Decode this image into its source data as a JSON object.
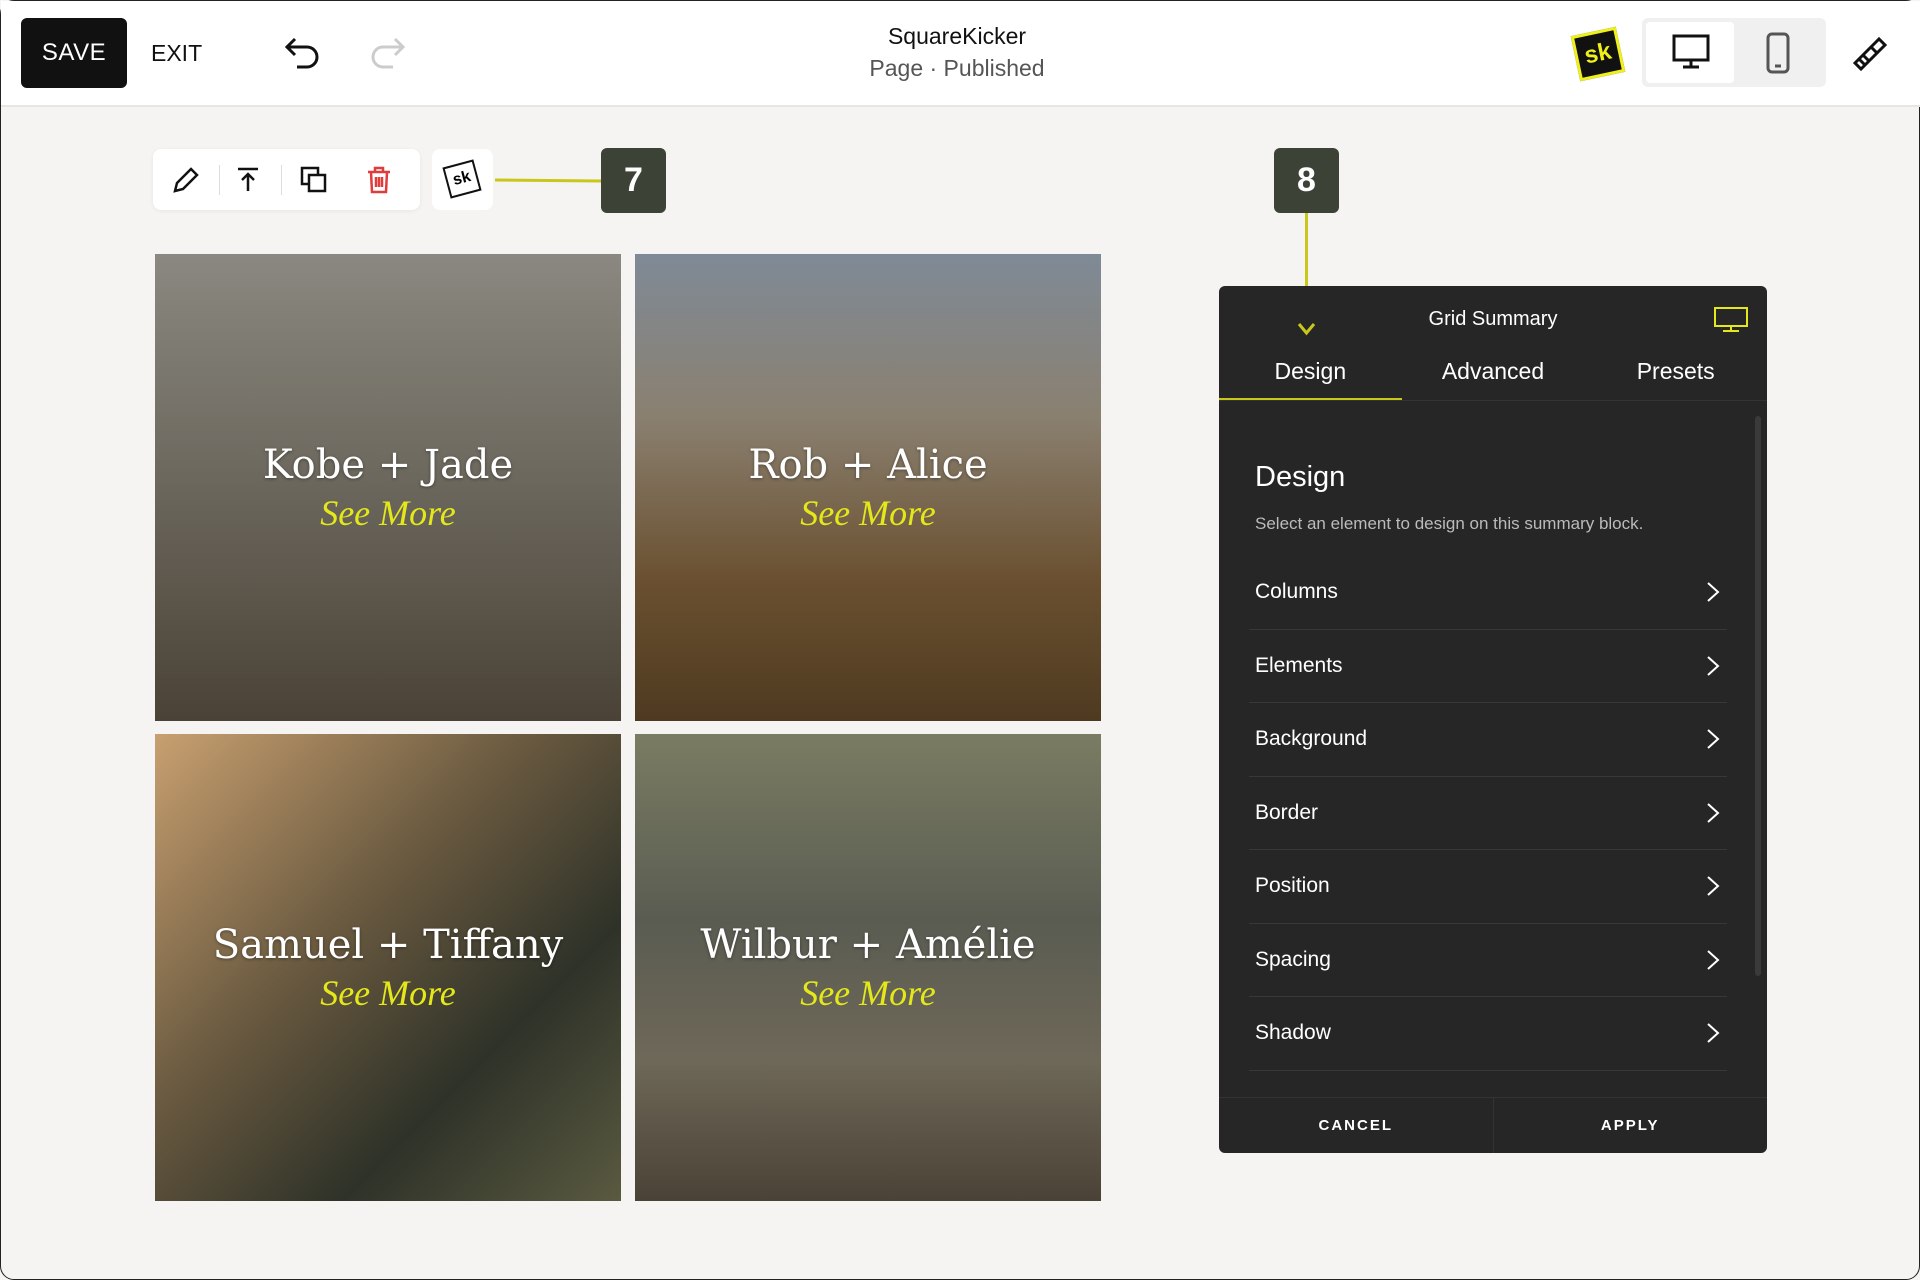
{
  "topbar": {
    "save_label": "SAVE",
    "exit_label": "EXIT",
    "title": "SquareKicker",
    "subtitle": "Page · Published",
    "logo_text": "sk"
  },
  "block_toolbar": {
    "icons": [
      "pencil-icon",
      "move-up-icon",
      "duplicate-icon",
      "trash-icon"
    ],
    "sk_label": "sk"
  },
  "callouts": {
    "badge_7": "7",
    "badge_8": "8",
    "accent": "#c9c71a"
  },
  "grid": {
    "items": [
      {
        "name": "Kobe + Jade",
        "link": "See More"
      },
      {
        "name": "Rob + Alice",
        "link": "See More"
      },
      {
        "name": "Samuel + Tiffany",
        "link": "See More"
      },
      {
        "name": "Wilbur + Amélie",
        "link": "See More"
      }
    ]
  },
  "panel": {
    "title": "Grid Summary",
    "tabs": [
      "Design",
      "Advanced",
      "Presets"
    ],
    "active_tab": "Design",
    "heading": "Design",
    "description": "Select an element to design on this summary block.",
    "items": [
      "Columns",
      "Elements",
      "Background",
      "Border",
      "Position",
      "Spacing",
      "Shadow"
    ],
    "cancel": "CANCEL",
    "apply": "APPLY"
  },
  "colors": {
    "panel_bg": "#262626",
    "accent": "#e4e81a",
    "badge": "#3d4237"
  }
}
